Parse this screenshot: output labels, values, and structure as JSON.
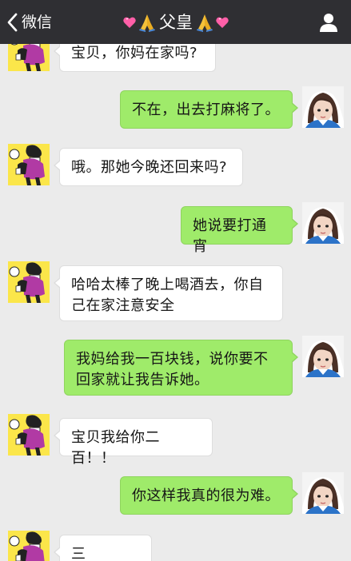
{
  "header": {
    "back_label": "微信",
    "title": "父皇",
    "icons": [
      "chevron-left-icon",
      "heart-emoji",
      "praying-hands-emoji",
      "person-icon"
    ]
  },
  "colors": {
    "topbar": "#2f2f33",
    "chat_background": "#ebebeb",
    "outgoing_bubble": "#9feb6a",
    "incoming_bubble": "#ffffff",
    "heart": "#ff5fa8"
  },
  "messages": [
    {
      "from": "father",
      "text": "宝贝，你妈在家吗?"
    },
    {
      "from": "me",
      "text": "不在，出去打麻将了。"
    },
    {
      "from": "father",
      "text": "哦。那她今晚还回来吗?"
    },
    {
      "from": "me",
      "text": "她说要打通宵"
    },
    {
      "from": "father",
      "text": "哈哈太棒了晚上喝酒去，你自\n己在家注意安全"
    },
    {
      "from": "me",
      "text": "我妈给我一百块钱，说你要不\n回家就让我告诉她。"
    },
    {
      "from": "father",
      "text": "宝贝我给你二百！！"
    },
    {
      "from": "me",
      "text": "你这样我真的很为难。"
    },
    {
      "from": "father",
      "text": "三百！！！"
    }
  ]
}
